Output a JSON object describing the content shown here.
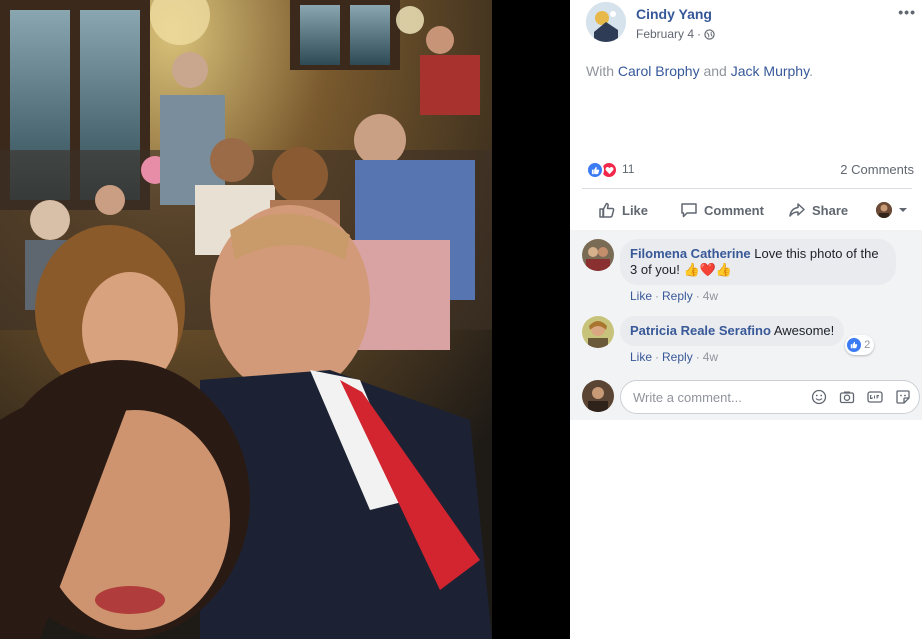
{
  "post": {
    "author": "Cindy Yang",
    "date": "February 4",
    "meta_sep": "·",
    "more": "•••",
    "privacy_icon": "globe-icon",
    "with_prefix": "With ",
    "tagged_1": "Carol Brophy",
    "with_and": " and ",
    "tagged_2": "Jack Murphy",
    "with_suffix": "."
  },
  "reactions": {
    "count": "11",
    "types": [
      "like",
      "love"
    ],
    "comments_count": "2 Comments"
  },
  "actions": {
    "like": "Like",
    "comment": "Comment",
    "share": "Share"
  },
  "comments": [
    {
      "name": "Filomena Catherine",
      "text": "Love this photo of the 3 of you! 👍❤️👍",
      "like": "Like",
      "reply": "Reply",
      "time": "4w"
    },
    {
      "name": "Patricia Reale Serafino",
      "text": "Awesome!",
      "like": "Like",
      "reply": "Reply",
      "time": "4w",
      "reaction_count": "2"
    }
  ],
  "composer": {
    "placeholder": "Write a comment..."
  },
  "colors": {
    "link": "#365899",
    "like_blue": "#3b7bf4",
    "love_red": "#f0284a"
  }
}
